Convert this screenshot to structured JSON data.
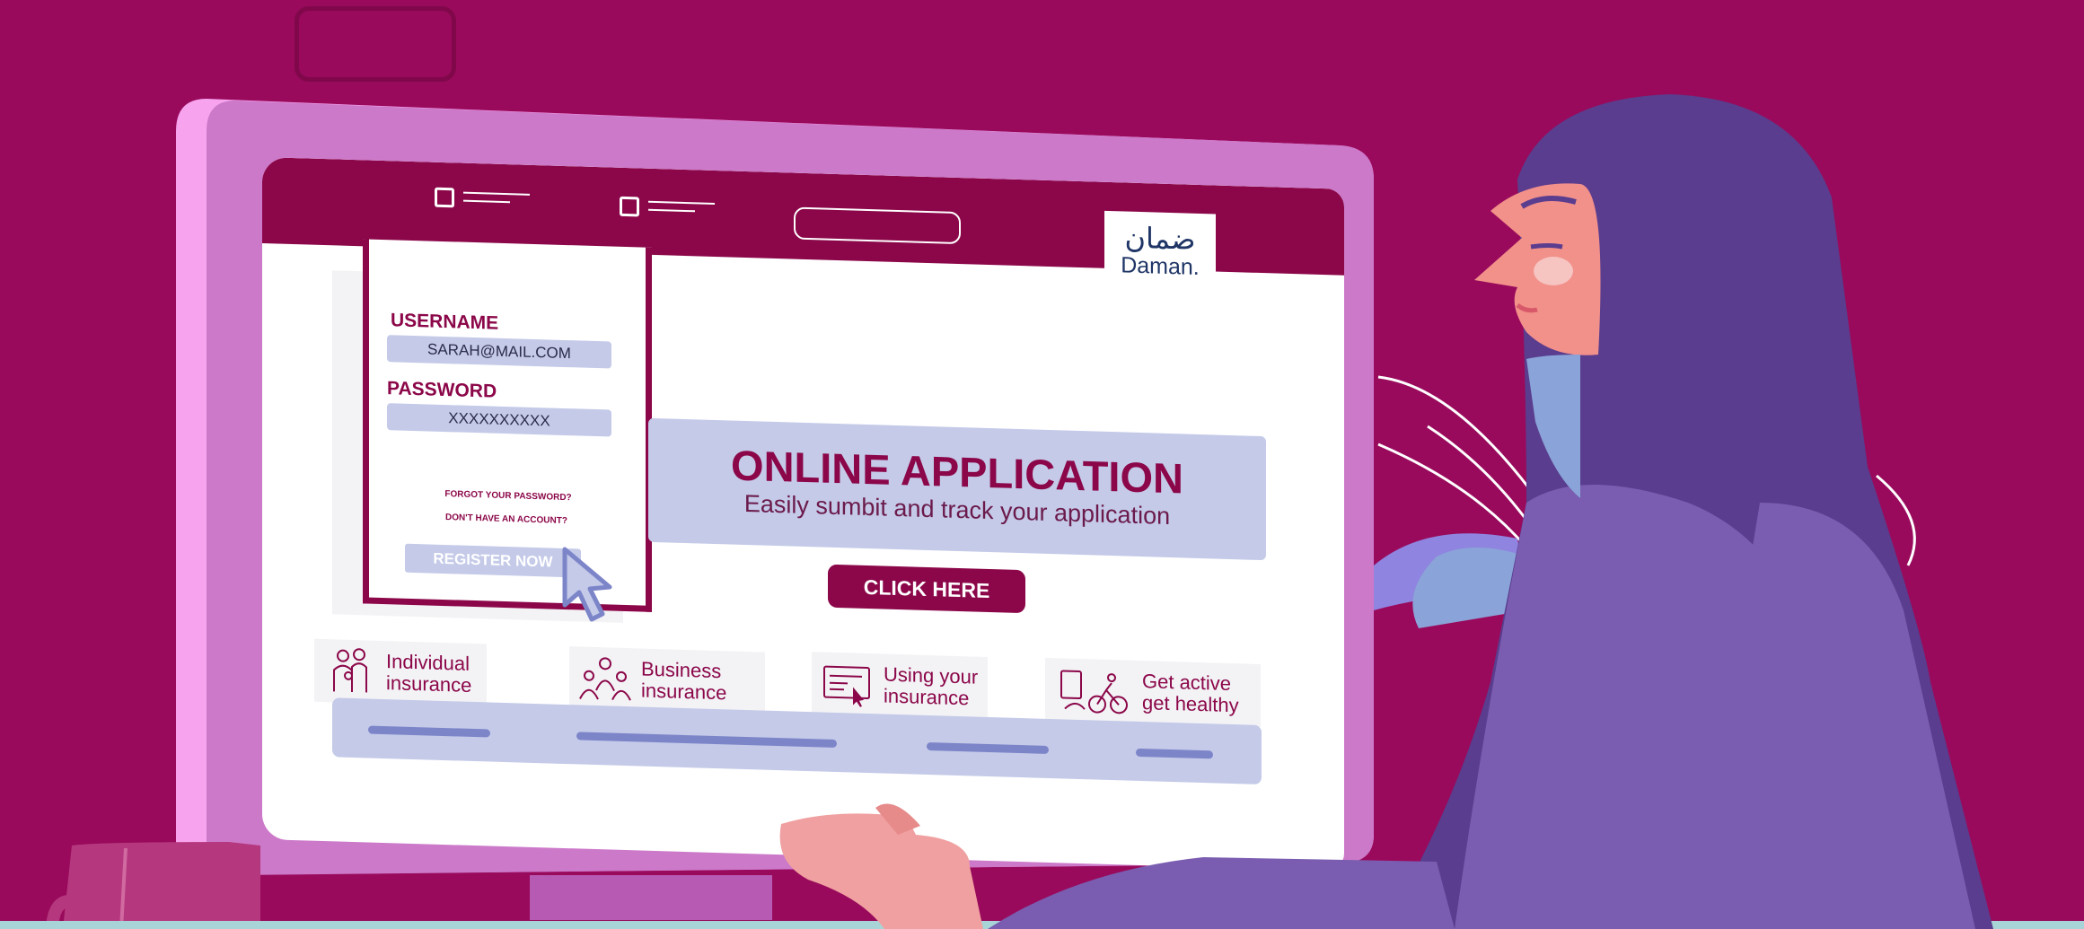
{
  "logo": {
    "arabic": "ضمان",
    "english": "Daman."
  },
  "login": {
    "username_label": "USERNAME",
    "username_value": "SARAH@MAIL.COM",
    "password_label": "PASSWORD",
    "password_value": "XXXXXXXXXX",
    "forgot_link": "FORGOT YOUR PASSWORD?",
    "no_account_link": "DON'T HAVE AN ACCOUNT?",
    "register_button": "REGISTER NOW"
  },
  "banner": {
    "title": "ONLINE APPLICATION",
    "subtitle": "Easily sumbit and track your application"
  },
  "cta": {
    "label": "CLICK HERE"
  },
  "categories": [
    {
      "line1": "Individual",
      "line2": "insurance",
      "icon": "family-icon"
    },
    {
      "line1": "Business",
      "line2": "insurance",
      "icon": "group-icon"
    },
    {
      "line1": "Using your",
      "line2": "insurance",
      "icon": "card-pointer-icon"
    },
    {
      "line1": "Get active",
      "line2": "get healthy",
      "icon": "cycling-icon"
    }
  ],
  "colors": {
    "background": "#990a5c",
    "brand": "#8b0749",
    "lavender": "#c4cae8",
    "monitor": "#cc79c9"
  }
}
